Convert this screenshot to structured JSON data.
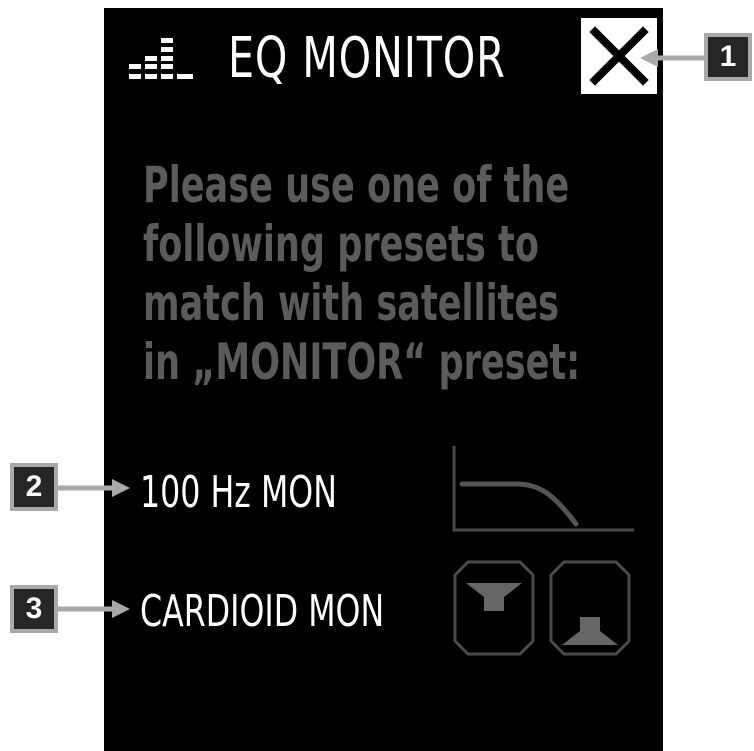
{
  "header": {
    "title": "EQ MONITOR",
    "icon": "equalizer-icon",
    "close_icon": "close-icon"
  },
  "message": {
    "lines": [
      "Please use one of the",
      "following presets to",
      "match with satellites",
      "in „MONITOR“ preset:"
    ]
  },
  "presets": [
    {
      "label": "100 Hz MON",
      "icon": "low-cut-filter-icon"
    },
    {
      "label": "CARDIOID MON",
      "icons": [
        "speaker-facing-down-icon",
        "speaker-facing-up-icon"
      ]
    }
  ],
  "callouts": [
    "1",
    "2",
    "3"
  ],
  "colors": {
    "panel": "#000000",
    "title": "#ffffff",
    "message": "#5b5b5b",
    "icon_outline": "#555555",
    "callout_bg": "#262626",
    "callout_border": "#a9a9a9"
  }
}
